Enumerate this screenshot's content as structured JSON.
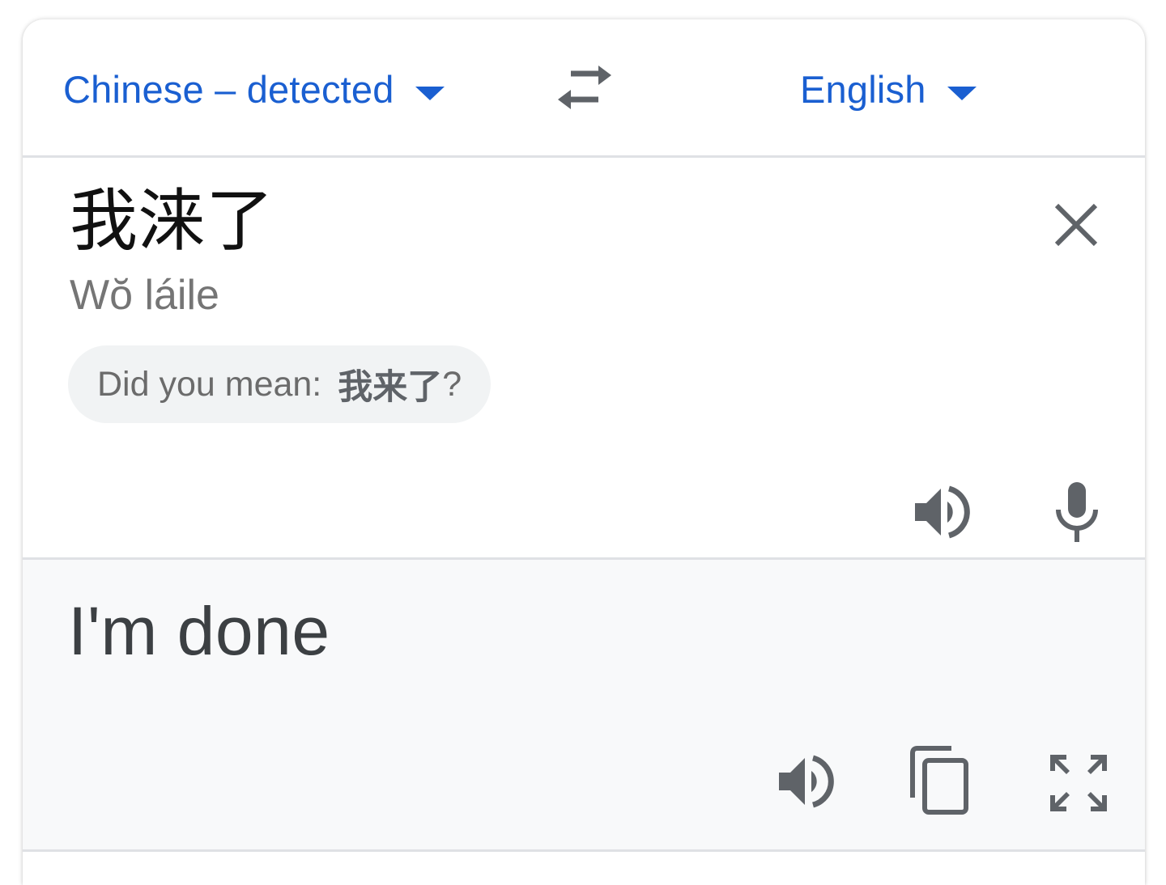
{
  "languages": {
    "source_label": "Chinese – detected",
    "target_label": "English"
  },
  "source": {
    "text": "我涞了",
    "romanization": "Wŏ láile",
    "suggestion_label": "Did you mean:",
    "suggestion_value": "我来了",
    "suggestion_suffix": "?"
  },
  "target": {
    "text": "I'm done"
  },
  "icons": {
    "swap": "swap-arrows-icon",
    "clear": "close-icon",
    "source_speak": "speaker-icon",
    "mic": "microphone-icon",
    "target_speak": "speaker-icon",
    "copy": "copy-icon",
    "expand": "fullscreen-icon"
  },
  "colors": {
    "accent": "#1a5fd1",
    "icon": "#5f6368",
    "divider": "#dfe1e5",
    "target_bg": "#f8f9fa"
  }
}
